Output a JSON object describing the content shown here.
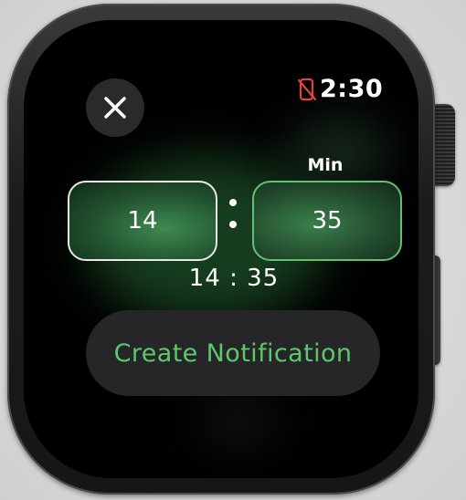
{
  "status": {
    "time": "2:30",
    "phone_icon": "phone-disconnected-icon",
    "phone_icon_color": "#e0453a"
  },
  "close_button": {
    "icon": "close-icon"
  },
  "picker": {
    "minute_label": "Min",
    "hour_value": "14",
    "minute_value": "35",
    "separator": ":",
    "selected": "minute"
  },
  "time_readout": "14 : 35",
  "create_button": {
    "label": "Create Notification",
    "color": "#5cc86b"
  },
  "colors": {
    "accent_green": "#5cc86b",
    "screen_background": "#000000"
  }
}
